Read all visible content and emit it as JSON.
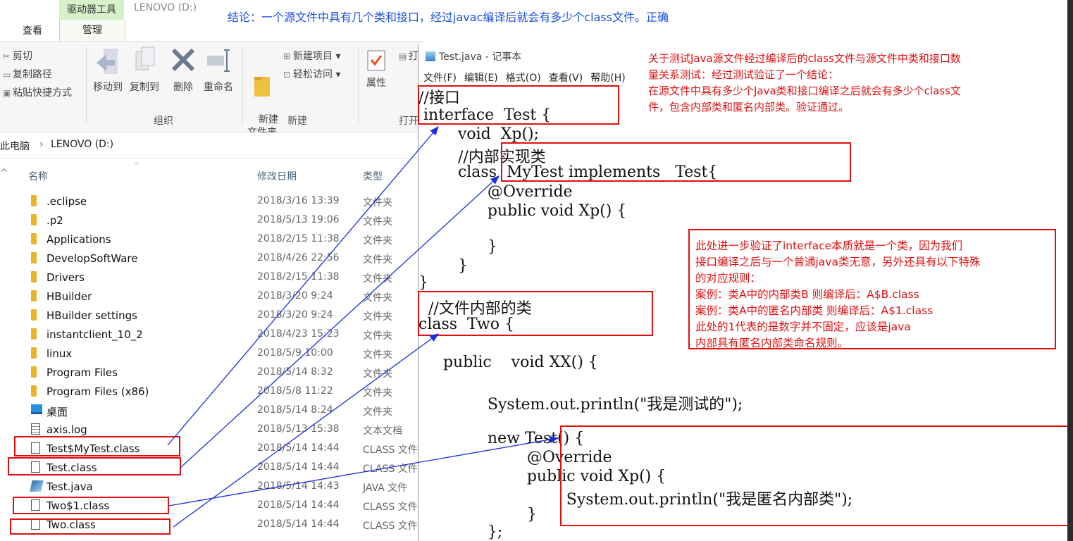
{
  "explorer": {
    "ribbon_tabs": {
      "context": "驱动器工具",
      "drive": "LENOVO (D:)",
      "view": "查看",
      "manage": "管理"
    },
    "ribbon": {
      "cut": "剪切",
      "copy_path": "复制路径",
      "paste_shortcut": "粘贴快捷方式",
      "move_to": "移动到",
      "copy_to": "复制到",
      "delete": "删除",
      "rename": "重命名",
      "new_folder": "新建\n文件夹",
      "new_item": "新建项目",
      "easy_access": "轻松访问",
      "properties": "属性",
      "open_partial": "打",
      "group_organize": "组织",
      "group_new": "新建",
      "group_open": "打开"
    },
    "address": {
      "pc": "此电脑",
      "sep": "›",
      "drive": "LENOVO (D:)"
    },
    "columns": {
      "name": "名称",
      "date": "修改日期",
      "type": "类型"
    },
    "files": [
      {
        "name": ".eclipse",
        "date": "2018/3/16 13:39",
        "type": "文件夹",
        "icon": "folder-icon"
      },
      {
        "name": ".p2",
        "date": "2018/5/13 19:06",
        "type": "文件夹",
        "icon": "folder-icon"
      },
      {
        "name": "Applications",
        "date": "2018/2/15 11:38",
        "type": "文件夹",
        "icon": "folder-icon"
      },
      {
        "name": "DevelopSoftWare",
        "date": "2018/4/26 22:56",
        "type": "文件夹",
        "icon": "folder-icon"
      },
      {
        "name": "Drivers",
        "date": "2018/2/15 11:38",
        "type": "文件夹",
        "icon": "folder-icon"
      },
      {
        "name": "HBuilder",
        "date": "2018/3/20 9:24",
        "type": "文件夹",
        "icon": "folder-icon"
      },
      {
        "name": "HBuilder settings",
        "date": "2018/3/20 9:24",
        "type": "文件夹",
        "icon": "folder-icon"
      },
      {
        "name": "instantclient_10_2",
        "date": "2018/4/23 15:23",
        "type": "文件夹",
        "icon": "folder-icon"
      },
      {
        "name": "linux",
        "date": "2018/5/9 10:00",
        "type": "文件夹",
        "icon": "folder-icon"
      },
      {
        "name": "Program Files",
        "date": "2018/5/14 8:32",
        "type": "文件夹",
        "icon": "folder-icon"
      },
      {
        "name": "Program Files (x86)",
        "date": "2018/5/8 11:22",
        "type": "文件夹",
        "icon": "folder-icon"
      },
      {
        "name": "桌面",
        "date": "2018/5/14 8:24",
        "type": "文件夹",
        "icon": "desktop-icon"
      },
      {
        "name": "axis.log",
        "date": "2018/5/13 15:38",
        "type": "文本文档",
        "icon": "text-file-icon"
      },
      {
        "name": "Test$MyTest.class",
        "date": "2018/5/14 14:44",
        "type": "CLASS 文件",
        "icon": "file-icon"
      },
      {
        "name": "Test.class",
        "date": "2018/5/14 14:44",
        "type": "CLASS 文件",
        "icon": "file-icon"
      },
      {
        "name": "Test.java",
        "date": "2018/5/14 14:43",
        "type": "JAVA 文件",
        "icon": "java-file-icon"
      },
      {
        "name": "Two$1.class",
        "date": "2018/5/14 14:44",
        "type": "CLASS 文件",
        "icon": "file-icon"
      },
      {
        "name": "Two.class",
        "date": "2018/5/14 14:44",
        "type": "CLASS 文件",
        "icon": "file-icon"
      }
    ]
  },
  "conclusion": "结论：一个源文件中具有几个类和接口，经过javac编译后就会有多少个class文件。正确",
  "notepad": {
    "title": "Test.java - 记事本",
    "menu": [
      "文件(F)",
      "编辑(E)",
      "格式(O)",
      "查看(V)",
      "帮助(H)"
    ],
    "code": [
      "//接口",
      " interface  Test {",
      "        void  Xp();",
      "        //内部实现类",
      "        class  MyTest implements   Test{",
      "              @Override",
      "              public void Xp() {",
      "",
      "              }",
      "        }",
      "}",
      "  //文件内部的类",
      "class  Two {",
      "",
      "     public    void XX() {",
      "",
      "              System.out.println(\"我是测试的\");",
      "",
      "              new Test() {",
      "                      @Override",
      "                      public void Xp() {",
      "                              System.out.println(\"我是匿名内部类\");",
      "                      }",
      "              };"
    ]
  },
  "notes": {
    "top_right": "关于测试Java源文件经过编译后的class文件与源文件中类和接口数量关系测试：经过测试验证了一个结论：在源文件中具有多少个Java类和接口编译之后就会有多少个class文件，包含内部类和匿名内部类。验证通过。",
    "top_right_lines": [
      "关于测试Java源文件经过编译后的class文件与源文件中类和接口数",
      "量关系测试：经过测试验证了一个结论：",
      "在源文件中具有多少个Java类和接口编译之后就会有多少个class文",
      "件，包含内部类和匿名内部类。验证通过。"
    ],
    "middle_lines": [
      "此处进一步验证了interface本质就是一个类，因为我们",
      "接口编译之后与一个普通java类无意，另外还具有以下特殊",
      "的对应规则：",
      "案例：类A中的内部类B  则编译后：A$B.class",
      "案例：类A中的匿名内部类  则编译后：A$1.class",
      "此处的1代表的是数字并不固定，应该是java",
      "内部具有匿名内部类命名规则。"
    ]
  },
  "colors": {
    "annotation_red": "#e01010",
    "arrow_blue": "#1a2ee0",
    "conclusion_blue": "#1a4fe0",
    "ribbon_context": "#d6f0c8"
  }
}
